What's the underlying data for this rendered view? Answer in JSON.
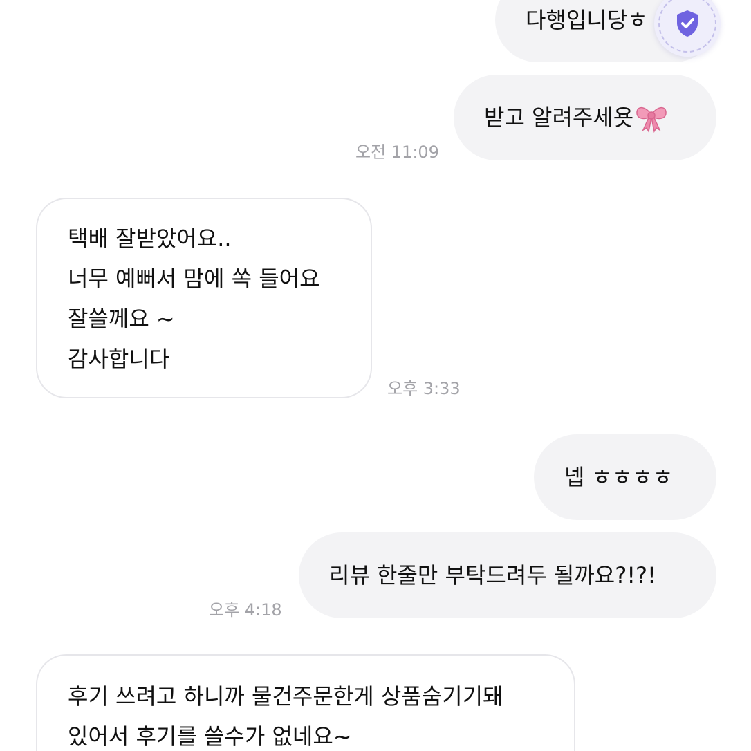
{
  "messages": [
    {
      "id": "m1",
      "direction": "out",
      "text": "다행입니당ㅎ"
    },
    {
      "id": "m2",
      "direction": "out",
      "text": "받고 알려주세욧",
      "emoji": "ribbon-icon"
    },
    {
      "id": "m3",
      "direction": "in",
      "lines": [
        "택배 잘받았어요..",
        "너무 예뻐서 맘에 쏙 들어요",
        "잘쓸께요 ~",
        "감사합니다"
      ]
    },
    {
      "id": "m4",
      "direction": "out",
      "text": "넵 ㅎㅎㅎㅎ"
    },
    {
      "id": "m5",
      "direction": "out",
      "text": "리뷰 한줄만 부탁드려두 될까요?!?!"
    },
    {
      "id": "m6",
      "direction": "in",
      "lines": [
        "후기 쓰려고 하니까 물건주문한게 상품숨기기돼",
        "있어서 후기를 쓸수가 없네요~"
      ]
    }
  ],
  "timestamps": {
    "t1": "오전 11:09",
    "t2": "오후 3:33",
    "t3": "오후 4:18"
  },
  "badge": {
    "icon": "verified-shield-icon",
    "color": "#6f63e0"
  },
  "colors": {
    "outgoing_bubble": "#f3f3f5",
    "incoming_border": "#e6e6ea",
    "timestamp": "#a3a3a8"
  }
}
